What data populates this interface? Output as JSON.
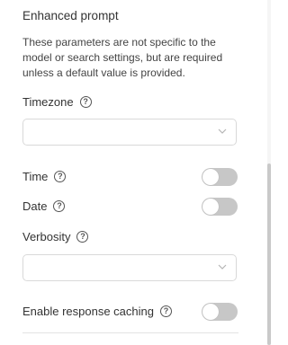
{
  "section": {
    "title": "Enhanced prompt",
    "description": "These parameters are not specific to the model or search settings, but are required unless a default value is provided."
  },
  "fields": {
    "timezone": {
      "label": "Timezone",
      "help_icon": "question-circle-icon",
      "value": ""
    },
    "time": {
      "label": "Time",
      "help_icon": "question-circle-icon",
      "enabled": false
    },
    "date": {
      "label": "Date",
      "help_icon": "question-circle-icon",
      "enabled": false
    },
    "verbosity": {
      "label": "Verbosity",
      "help_icon": "question-circle-icon",
      "value": ""
    },
    "response_caching": {
      "label": "Enable response caching",
      "help_icon": "question-circle-icon",
      "enabled": false
    }
  },
  "icons": {
    "help_glyph": "?",
    "dropdown": "chevron-down-icon"
  },
  "colors": {
    "toggle_off": "#c7c7c7",
    "border": "#d9d9d9",
    "text": "#333333"
  }
}
